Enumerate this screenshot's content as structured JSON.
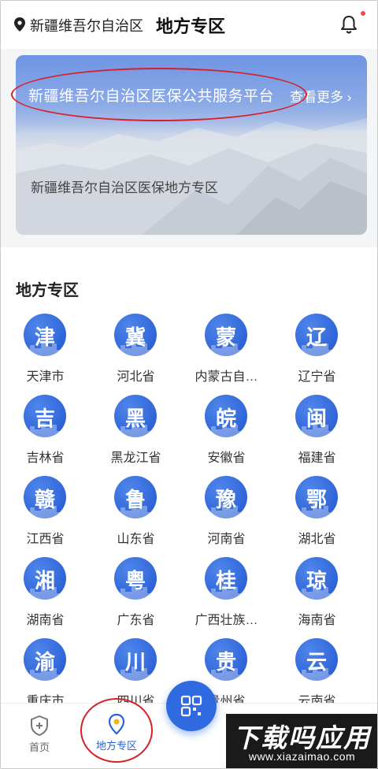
{
  "header": {
    "location": "新疆维吾尔自治区",
    "title": "地方专区"
  },
  "banner": {
    "title": "新疆维吾尔自治区医保公共服务平台",
    "more": "查看更多",
    "subtitle": "新疆维吾尔自治区医保地方专区"
  },
  "section": {
    "title": "地方专区"
  },
  "regions": [
    {
      "char": "津",
      "name": "天津市"
    },
    {
      "char": "冀",
      "name": "河北省"
    },
    {
      "char": "蒙",
      "name": "内蒙古自…"
    },
    {
      "char": "辽",
      "name": "辽宁省"
    },
    {
      "char": "吉",
      "name": "吉林省"
    },
    {
      "char": "黑",
      "name": "黑龙江省"
    },
    {
      "char": "皖",
      "name": "安徽省"
    },
    {
      "char": "闽",
      "name": "福建省"
    },
    {
      "char": "赣",
      "name": "江西省"
    },
    {
      "char": "鲁",
      "name": "山东省"
    },
    {
      "char": "豫",
      "name": "河南省"
    },
    {
      "char": "鄂",
      "name": "湖北省"
    },
    {
      "char": "湘",
      "name": "湖南省"
    },
    {
      "char": "粤",
      "name": "广东省"
    },
    {
      "char": "桂",
      "name": "广西壮族…"
    },
    {
      "char": "琼",
      "name": "海南省"
    },
    {
      "char": "渝",
      "name": "重庆市"
    },
    {
      "char": "川",
      "name": "四川省"
    },
    {
      "char": "贵",
      "name": "贵州省"
    },
    {
      "char": "云",
      "name": "云南省"
    }
  ],
  "nav": {
    "home": "首页",
    "local": "地方专区"
  },
  "icons": {
    "location": "location-pin-icon",
    "bell": "bell-icon",
    "home": "shield-plus-icon",
    "local": "map-pin-icon",
    "scan": "qr-scan-icon"
  },
  "colors": {
    "accent": "#2f6ae0",
    "badge": "#3a72e0",
    "annotation": "#d8202a"
  },
  "watermark": {
    "main": "下载吗应用",
    "url": "www.xiazaimao.com"
  }
}
